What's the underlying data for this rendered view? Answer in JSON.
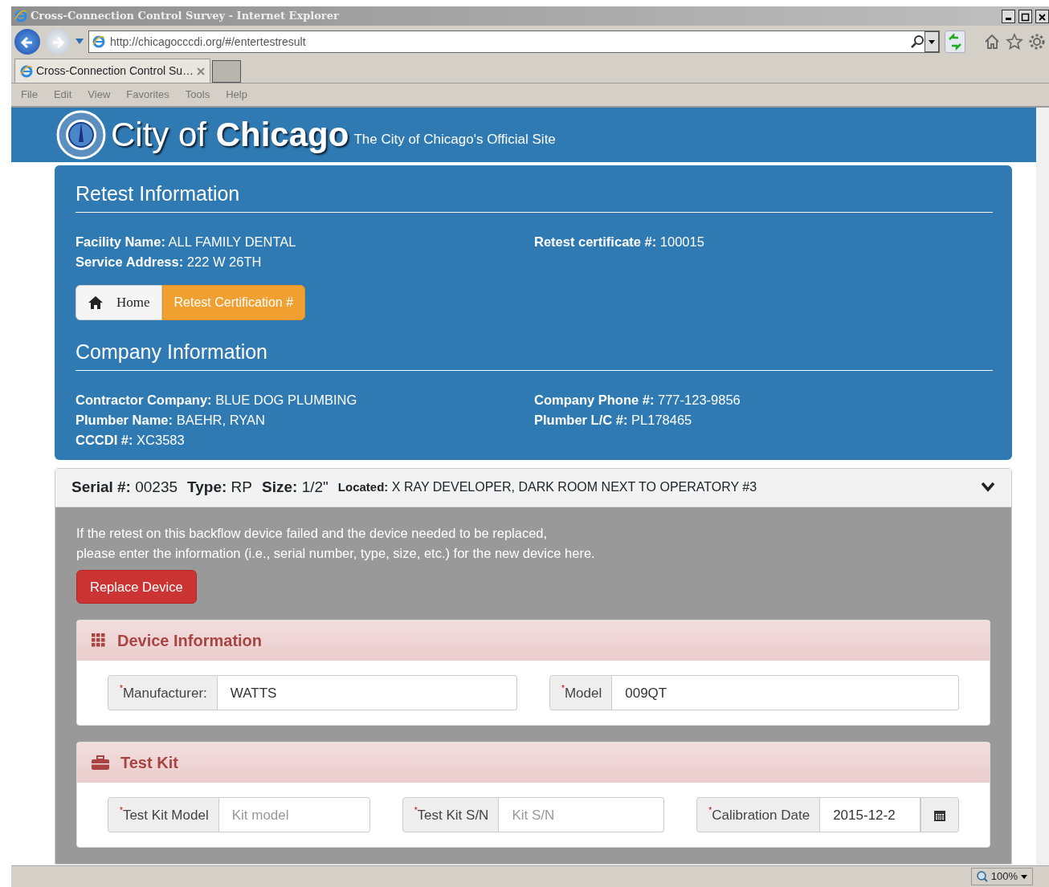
{
  "window": {
    "title": "Cross-Connection Control Survey - Internet Explorer"
  },
  "address_bar": {
    "url": "http://chicagocccdi.org/#/entertestresult"
  },
  "tabs": [
    {
      "label": "Cross-Connection Control Su…",
      "selected": true
    }
  ],
  "menu": [
    "File",
    "Edit",
    "View",
    "Favorites",
    "Tools",
    "Help"
  ],
  "site_header": {
    "logo_text": "City of **Chicago**",
    "tagline": "The City of Chicago's Official Site"
  },
  "retest": {
    "heading": "Retest Information",
    "left_fields": [
      {
        "label": "Facility Name:",
        "value": "ALL FAMILY DENTAL"
      },
      {
        "label": "Service Address:",
        "value": "222 W 26TH"
      }
    ],
    "right_fields": [
      {
        "label": "Retest certificate #:",
        "value": "100015"
      }
    ],
    "buttons": [
      {
        "kind": "home",
        "label": "Home"
      },
      {
        "kind": "warning",
        "label": "Retest Certification #"
      }
    ]
  },
  "company": {
    "heading": "Company Information",
    "left_fields": [
      {
        "label": "Contractor Company:",
        "value": "BLUE DOG PLUMBING"
      },
      {
        "label": "Plumber Name:",
        "value": "BAEHR, RYAN"
      },
      {
        "label": "CCCDI #:",
        "value": "XC3583"
      }
    ],
    "right_fields": [
      {
        "label": "Company Phone #:",
        "value": "777-123-9856"
      },
      {
        "label": "Plumber L/C #:",
        "value": "PL178465"
      }
    ]
  },
  "device": {
    "expanded": true,
    "summary": [
      {
        "label": "Serial #:",
        "value": "00235"
      },
      {
        "label": "Type:",
        "value": "RP"
      },
      {
        "label": "Size:",
        "value": "1/2\""
      }
    ],
    "located": {
      "label": "Located:",
      "value": "X RAY DEVELOPER, DARK ROOM NEXT TO OPERATORY #3"
    },
    "notice_lines": [
      "If the retest on this backflow device failed and the device needed to be replaced,",
      "please enter the information (i.e., serial number, type, size, etc.) for the new device here."
    ],
    "replace_button": "Replace Device",
    "sections": [
      {
        "title": "Device Information",
        "kind": "grid",
        "fields": [
          {
            "kind": "text",
            "label": "$^{*}$Manufacturer:",
            "value": "WATTS"
          },
          {
            "kind": "text",
            "label": "$^{*}$Model",
            "value": "009QT"
          }
        ]
      },
      {
        "title": "Test Kit",
        "kind": "briefcase",
        "fields": [
          {
            "kind": "text",
            "label": "$^{*}$Test Kit Model",
            "placeholder": "Kit model"
          },
          {
            "kind": "text",
            "label": "$^{*}$Test Kit S/N",
            "placeholder": "Kit S/N"
          },
          {
            "kind": "date",
            "label": "$^{*}$Calibration Date",
            "value": "2015-12-2"
          }
        ]
      }
    ]
  },
  "status_bar": {
    "zoom": "100%"
  }
}
